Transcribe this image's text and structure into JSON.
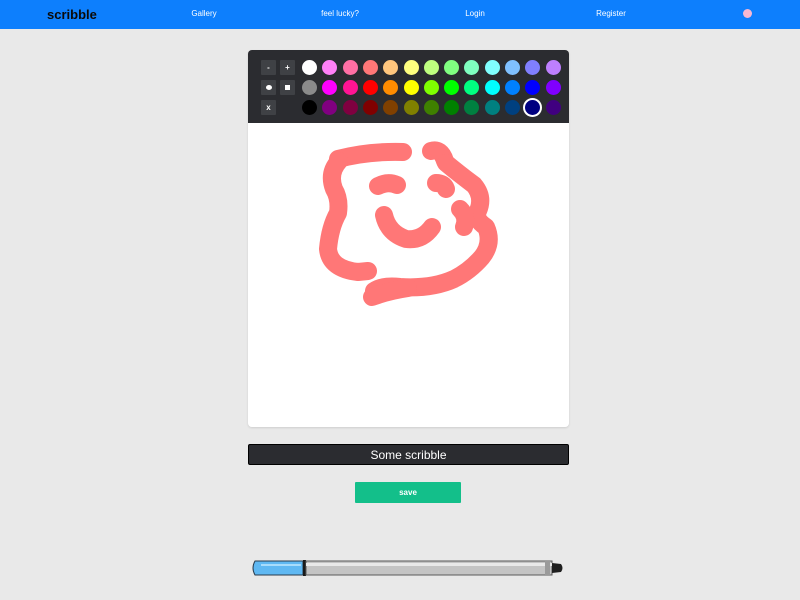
{
  "navbar": {
    "brand": "scribble",
    "links": [
      "Gallery",
      "feel lucky?",
      "Login",
      "Register"
    ],
    "background_color": "#0d7ffd",
    "status_dot_color": "#f7b8d2"
  },
  "toolbar": {
    "brush_buttons": [
      "-",
      "+"
    ],
    "shape_buttons": [
      "round-brush-icon",
      "square-brush-icon"
    ],
    "clear_button": "x",
    "palette_rows": [
      [
        "#ffffff",
        "#ff80f6",
        "#ff6fa4",
        "#ff7777",
        "#ffc67d",
        "#ffff7f",
        "#bfff7f",
        "#80ff80",
        "#7fffc0",
        "#80ffff",
        "#7fc0ff",
        "#807fff",
        "#be7fff"
      ],
      [
        "#8b8b8b",
        "#ff00ff",
        "#ff1493",
        "#ff0000",
        "#ff8c00",
        "#ffff00",
        "#7fff00",
        "#00ff00",
        "#00ff80",
        "#00ffff",
        "#0080ff",
        "#0000ff",
        "#8000ff"
      ],
      [
        "#000000",
        "#800080",
        "#7f0040",
        "#800000",
        "#804000",
        "#808000",
        "#3f8000",
        "#008000",
        "#008040",
        "#008080",
        "#004080",
        "#000080",
        "#400080"
      ]
    ],
    "selected_color": "#000080"
  },
  "canvas": {
    "stroke_color": "#ff7777"
  },
  "title_input": {
    "value": "Some scribble"
  },
  "save_button": {
    "label": "save"
  }
}
